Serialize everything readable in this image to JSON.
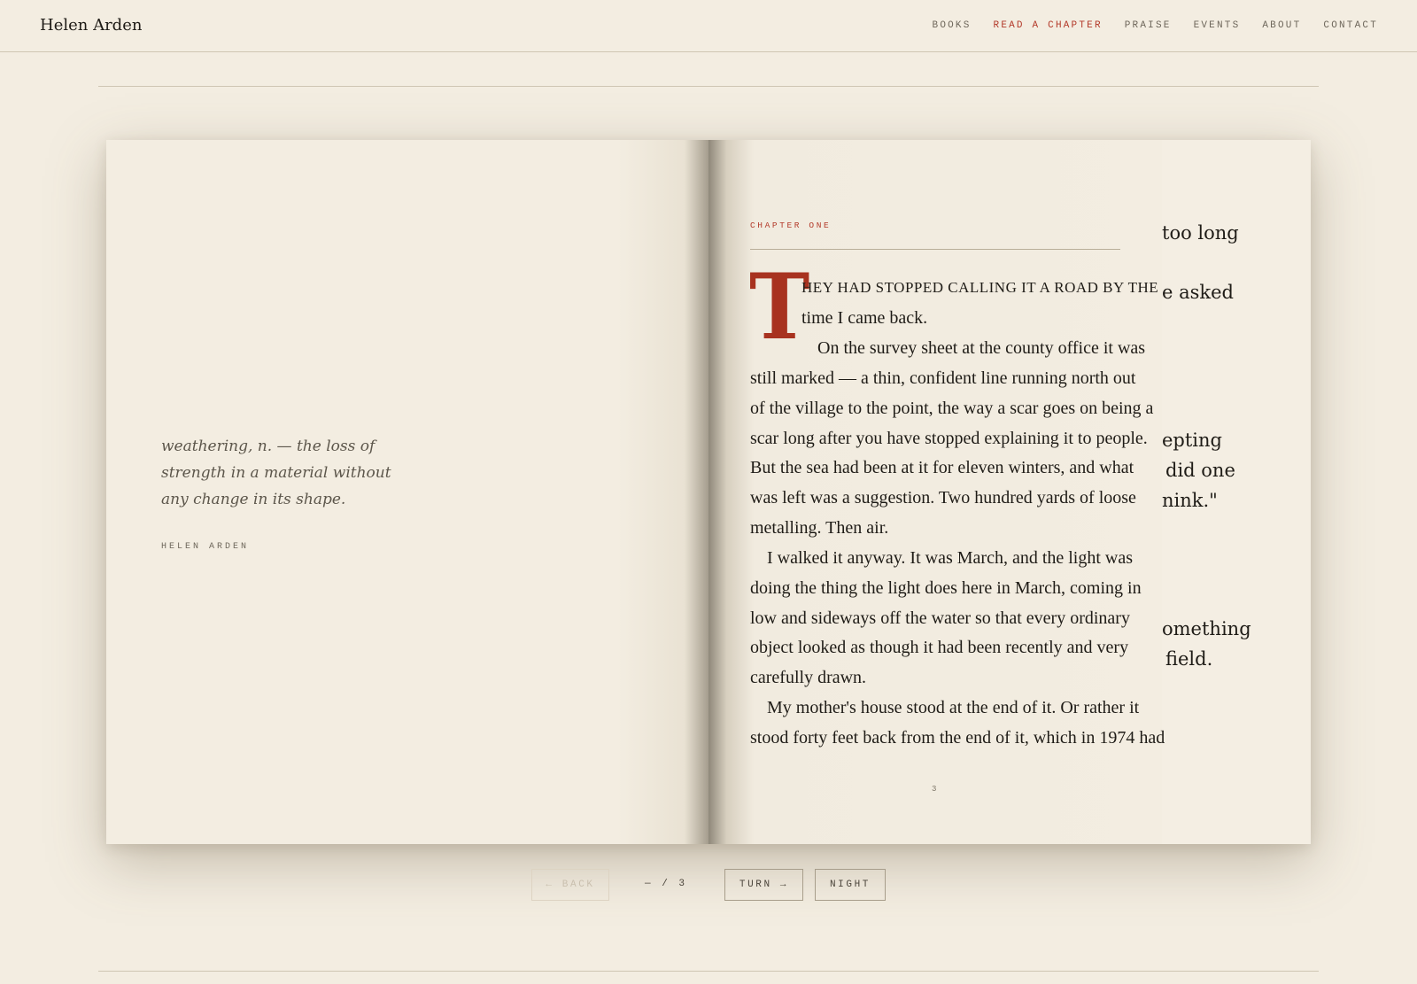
{
  "site": {
    "title": "Helen Arden"
  },
  "nav": {
    "items": [
      {
        "label": "BOOKS"
      },
      {
        "label": "READ A CHAPTER",
        "active": true
      },
      {
        "label": "PRAISE"
      },
      {
        "label": "EVENTS"
      },
      {
        "label": "ABOUT"
      },
      {
        "label": "CONTACT"
      }
    ]
  },
  "left_page": {
    "epigraph": "weathering, n. — the loss of strength in a material without any change in its shape.",
    "author": "HELEN ARDEN"
  },
  "right_page": {
    "chapter_label": "CHAPTER ONE",
    "drop_cap": "T",
    "lines": [
      "HEY HAD STOPPED CALLING IT A ROAD BY THE",
      "time I came back.",
      "On the survey sheet at the county office it was",
      "still marked — a thin, confident line running north out",
      "of the village to the point, the way a scar goes on being a",
      "scar long after you have stopped explaining it to people.",
      "But the sea had been at it for eleven winters, and what",
      "was left was a suggestion. Two hundred yards of loose",
      "metalling. Then air.",
      "I walked it anyway. It was March, and the light was",
      "doing the thing the light does here in March, coming in",
      "low and sideways off the water so that every ordinary",
      "object looked as though it had been recently and very",
      "carefully drawn.",
      "My mother's house stood at the end of it. Or rather it",
      "stood forty feet back from the end of it, which in 1974 had"
    ],
    "page_number": "3"
  },
  "next_page_peek": {
    "fragments": [
      "too long",
      "e asked",
      "epting",
      "did one",
      "nink.\"",
      "omething",
      "field."
    ]
  },
  "controls": {
    "back_label": "← BACK",
    "page_indicator": "— / 3",
    "turn_label": "TURN →",
    "night_label": "NIGHT"
  },
  "colors": {
    "background": "#f3ede1",
    "accent": "#b33a2a",
    "dropcap": "#a8321f",
    "text": "#1f1c17"
  }
}
